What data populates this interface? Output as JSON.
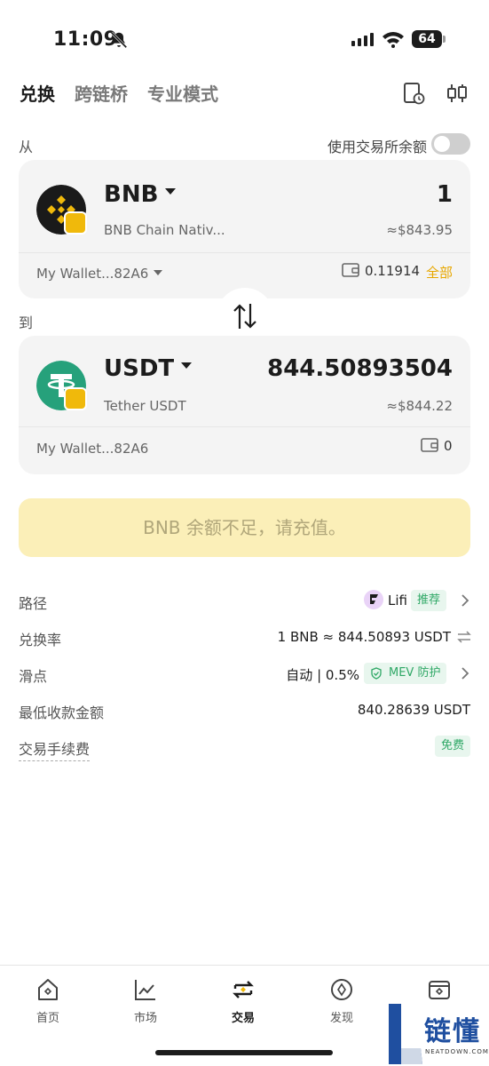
{
  "status_bar": {
    "time": "11:09",
    "battery": "64"
  },
  "tabs": [
    {
      "label": "兑换",
      "active": true
    },
    {
      "label": "跨链桥",
      "active": false
    },
    {
      "label": "专业模式",
      "active": false
    }
  ],
  "from_label": "从",
  "to_label": "到",
  "use_trading_balance": {
    "label": "使用交易所余额",
    "enabled": false
  },
  "from": {
    "symbol": "BNB",
    "name": "BNB Chain Nativ...",
    "amount": "1",
    "fiat": "≈$843.95",
    "wallet": "My Wallet...82A6",
    "balance": "0.11914",
    "max_label": "全部"
  },
  "to": {
    "symbol": "USDT",
    "name": "Tether USDT",
    "amount": "844.50893504",
    "fiat": "≈$844.22",
    "wallet": "My Wallet...82A6",
    "balance": "0"
  },
  "warning_button": "BNB 余额不足，请充值。",
  "details": {
    "route": {
      "label": "路径",
      "provider": "Lifi",
      "tag": "推荐"
    },
    "rate": {
      "label": "兑换率",
      "value": "1 BNB ≈ 844.50893 USDT"
    },
    "slippage": {
      "label": "滑点",
      "value": "自动 | 0.5%",
      "mev": "MEV 防护"
    },
    "min_received": {
      "label": "最低收款金额",
      "value": "840.28639 USDT"
    },
    "fee": {
      "label": "交易手续费",
      "tag": "免费"
    }
  },
  "tabbar": [
    {
      "label": "首页",
      "icon": "home-icon",
      "active": false
    },
    {
      "label": "市场",
      "icon": "chart-icon",
      "active": false
    },
    {
      "label": "交易",
      "icon": "swap-icon",
      "active": true
    },
    {
      "label": "发现",
      "icon": "compass-icon",
      "active": false
    },
    {
      "label": "",
      "icon": "wallet-icon",
      "active": false
    }
  ],
  "watermark": {
    "title": "链懂",
    "subtitle": "NEATDOWN.COM"
  },
  "colors": {
    "accent": "#f0b90b",
    "warning_bg": "#fbefb8",
    "success": "#2fa866",
    "tether": "#26a17b"
  }
}
